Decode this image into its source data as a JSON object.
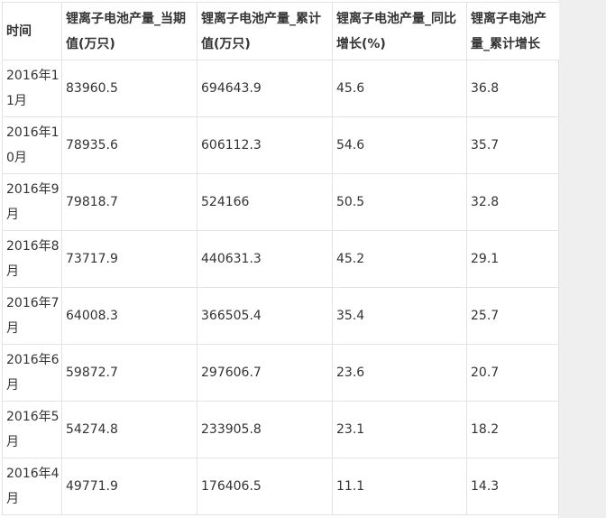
{
  "table": {
    "headers": [
      "时间",
      "锂离子电池产量_当期值(万只)",
      "锂离子电池产量_累计值(万只)",
      "锂离子电池产量_同比增长(%)",
      "锂离子电池产量_累计增长(%)"
    ],
    "rows": [
      {
        "time": "2016年11月",
        "current": "83960.5",
        "cumulative": "694643.9",
        "yoy": "45.6",
        "cum_growth": "36.8"
      },
      {
        "time": "2016年10月",
        "current": "78935.6",
        "cumulative": "606112.3",
        "yoy": "54.6",
        "cum_growth": "35.7"
      },
      {
        "time": "2016年9月",
        "current": "79818.7",
        "cumulative": "524166",
        "yoy": "50.5",
        "cum_growth": "32.8"
      },
      {
        "time": "2016年8月",
        "current": "73717.9",
        "cumulative": "440631.3",
        "yoy": "45.2",
        "cum_growth": "29.1"
      },
      {
        "time": "2016年7月",
        "current": "64008.3",
        "cumulative": "366505.4",
        "yoy": "35.4",
        "cum_growth": "25.7"
      },
      {
        "time": "2016年6月",
        "current": "59872.7",
        "cumulative": "297606.7",
        "yoy": "23.6",
        "cum_growth": "20.7"
      },
      {
        "time": "2016年5月",
        "current": "54274.8",
        "cumulative": "233905.8",
        "yoy": "23.1",
        "cum_growth": "18.2"
      },
      {
        "time": "2016年4月",
        "current": "49771.9",
        "cumulative": "176406.5",
        "yoy": "11.1",
        "cum_growth": "14.3"
      }
    ]
  },
  "colors": {
    "border": "#e3e3e3",
    "text": "#333333",
    "gutter": "#efefef"
  }
}
